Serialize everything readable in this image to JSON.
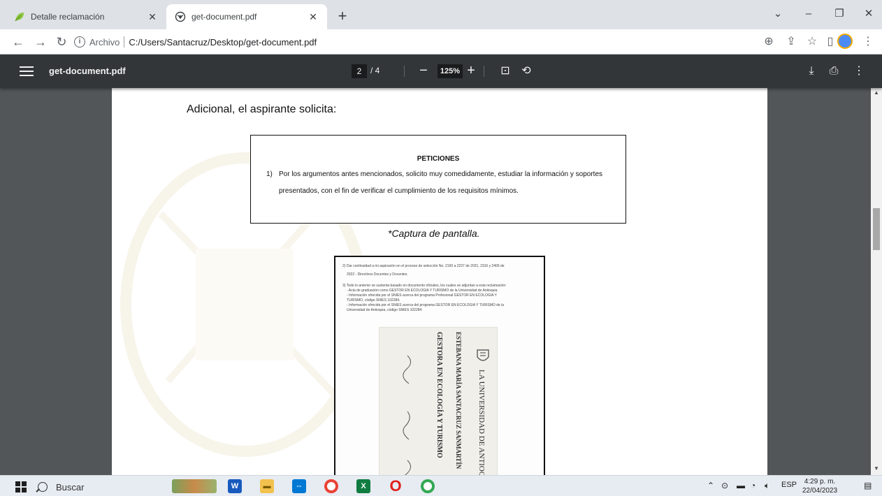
{
  "browser": {
    "tabs": [
      {
        "title": "Detalle reclamación",
        "icon": "leaf-icon",
        "active": false
      },
      {
        "title": "get-document.pdf",
        "icon": "globe-icon",
        "active": true
      }
    ],
    "address": {
      "scheme_label": "Archivo",
      "url": "C:/Users/Santacruz/Desktop/get-document.pdf"
    }
  },
  "pdf_viewer": {
    "title": "get-document.pdf",
    "current_page": "2",
    "total_pages": "/ 4",
    "zoom": "125%"
  },
  "document": {
    "intro": "Adicional, el aspirante solicita:",
    "petitions": {
      "title": "PETICIONES",
      "number": "1)",
      "line1": "Por los argumentos antes mencionados, solicito muy comedidamente, estudiar la información y soportes",
      "line2": "presentados, con el fin de verificar el cumplimiento de los requisitos mínimos."
    },
    "caption": "*Captura de pantalla.",
    "screenshot": {
      "lines": [
        "2)  Dar continuidad a mi aspiración en el proceso de selección No. 2150 a 2237 de 2021, 2316 y 2406 de",
        "2022 - Directivos Docentes y Docentes.",
        "3)  Todo lo anterior se sustenta basado en documento oficiales, los cuales se adjuntan a esta reclamación:",
        "- Acta de graduación como GESTOR EN ECOLOGIA Y TURISMO de la Universidad de Antioquia.",
        "- Información ofrecida por el SNIES acerca del programa Profesional GESTOR EN ECOLOGIA Y",
        "TURISMO, código SNIES 102284.",
        "- Información ofrecida por el SNIES acerca del programa GESTOR EN ECOLOGIA Y TURISMO de la",
        "Universidad de Antioquia, código SNIES 102284."
      ],
      "diploma": {
        "university": "LA UNIVERSIDAD DE ANTIOQUIA",
        "name": "ESTEBANA MARÍA SANTACRUZ SANMARTÍN",
        "degree": "GESTORA EN ECOLOGÍA Y TURISMO"
      }
    }
  },
  "taskbar": {
    "search_label": "Buscar",
    "language": "ESP",
    "time": "4:29 p. m.",
    "date": "22/04/2023"
  }
}
